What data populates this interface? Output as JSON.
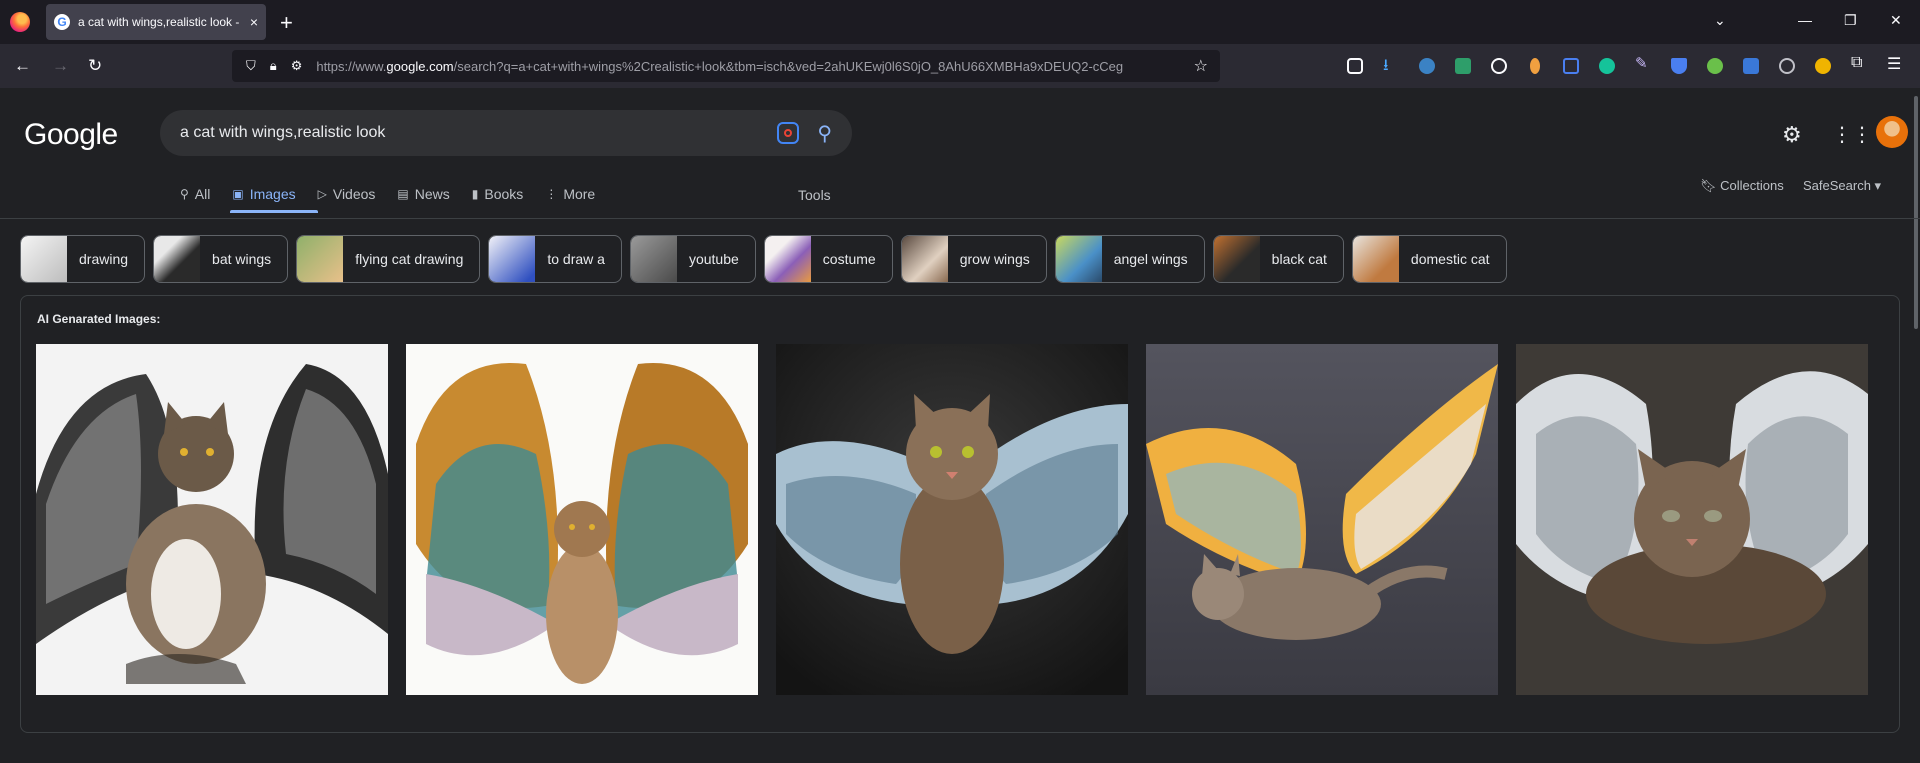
{
  "browser": {
    "tab_title": "a cat with wings,realistic look - ",
    "tab_close": "×",
    "new_tab": "+",
    "url_host_prefix": "https://www.",
    "url_host": "google.com",
    "url_path": "/search?q=a+cat+with+wings%2Crealistic+look&tbm=isch&ved=2ahUKEwj0l6S0jO_8AhU66XMBHa9xDEUQ2-cCeg"
  },
  "header": {
    "logo": "Google",
    "query": "a cat with wings,realistic look"
  },
  "tabs": [
    {
      "label": "All",
      "icon": "search-icon"
    },
    {
      "label": "Images",
      "icon": "image-icon"
    },
    {
      "label": "Videos",
      "icon": "play-icon"
    },
    {
      "label": "News",
      "icon": "news-icon"
    },
    {
      "label": "Books",
      "icon": "book-icon"
    },
    {
      "label": "More",
      "icon": "more-icon"
    }
  ],
  "tools_label": "Tools",
  "collections_label": "Collections",
  "safesearch_label": "SafeSearch",
  "chips": [
    {
      "label": "drawing",
      "color": "#d8d8d8"
    },
    {
      "label": "bat wings",
      "color": "#5a5a5a"
    },
    {
      "label": "flying cat drawing",
      "color": "#c9a15a"
    },
    {
      "label": "to draw a",
      "color": "#e6e3f0"
    },
    {
      "label": "youtube",
      "color": "#6b6b6b"
    },
    {
      "label": "costume",
      "color": "#8b5fb8"
    },
    {
      "label": "grow wings",
      "color": "#a89a8a"
    },
    {
      "label": "angel wings",
      "color": "#7aa0c8"
    },
    {
      "label": "black cat",
      "color": "#6b4a2a"
    },
    {
      "label": "domestic cat",
      "color": "#c4b8a8"
    }
  ],
  "ai_section": {
    "title": "AI Genarated Images:"
  }
}
